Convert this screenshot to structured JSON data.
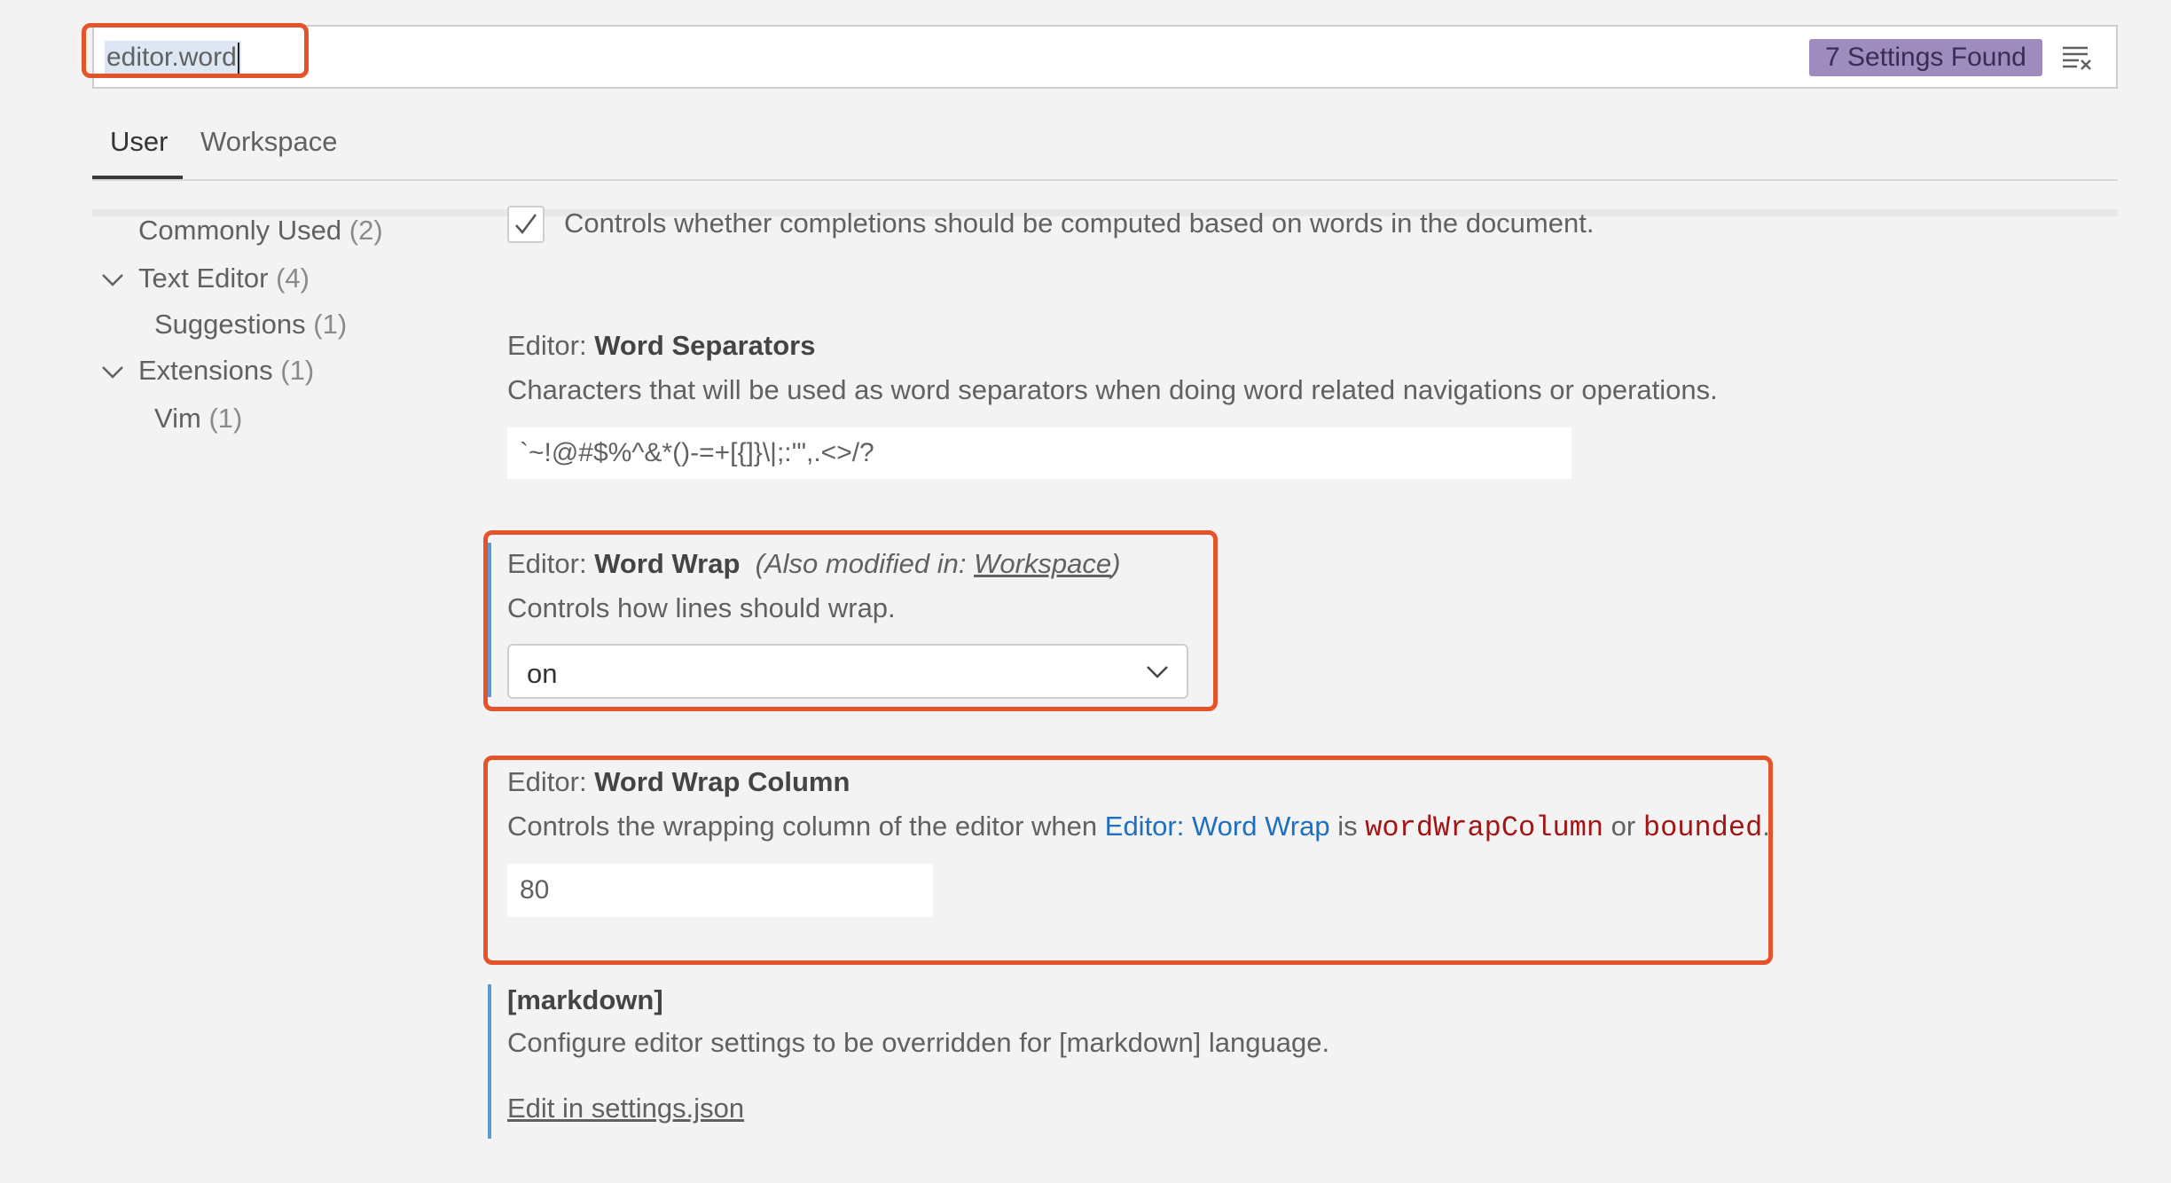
{
  "search": {
    "value": "editor.word",
    "results_badge": "7 Settings Found"
  },
  "tabs": [
    {
      "label": "User"
    },
    {
      "label": "Workspace"
    }
  ],
  "toc": [
    {
      "label": "Commonly Used",
      "count": "(2)"
    },
    {
      "label": "Text Editor",
      "count": "(4)"
    },
    {
      "label": "Suggestions",
      "count": "(1)"
    },
    {
      "label": "Extensions",
      "count": "(1)"
    },
    {
      "label": "Vim",
      "count": "(1)"
    }
  ],
  "settings": {
    "word_based": {
      "description": "Controls whether completions should be computed based on words in the document.",
      "checked": true
    },
    "separators": {
      "category": "Editor:",
      "name": "Word Separators",
      "description": "Characters that will be used as word separators when doing word related navigations or operations.",
      "value": "`~!@#$%^&*()-=+[{]}\\|;:'\",.<>/?"
    },
    "wrap": {
      "category": "Editor:",
      "name": "Word Wrap",
      "modified_prefix": "(Also modified in: ",
      "modified_link": "Workspace",
      "modified_suffix": ")",
      "description": "Controls how lines should wrap.",
      "value": "on"
    },
    "wrap_column": {
      "category": "Editor:",
      "name": "Word Wrap Column",
      "desc_part1": "Controls the wrapping column of the editor when ",
      "desc_link": "Editor: Word Wrap",
      "desc_part2": " is ",
      "code1": "wordWrapColumn",
      "desc_part3": " or ",
      "code2": "bounded",
      "desc_part4": ".",
      "value": "80"
    },
    "markdown": {
      "name": "[markdown]",
      "description": "Configure editor settings to be overridden for [markdown] language.",
      "link": "Edit in settings.json"
    }
  },
  "colors": {
    "badge": "#9f8cbe",
    "highlight": "#e4532a",
    "modified_bar": "#5b9bd5",
    "code": "#a31515",
    "link": "#1f6fbf"
  },
  "icons": [
    "clear-filter-icon",
    "checkmark-icon",
    "chevron-down-icon"
  ]
}
